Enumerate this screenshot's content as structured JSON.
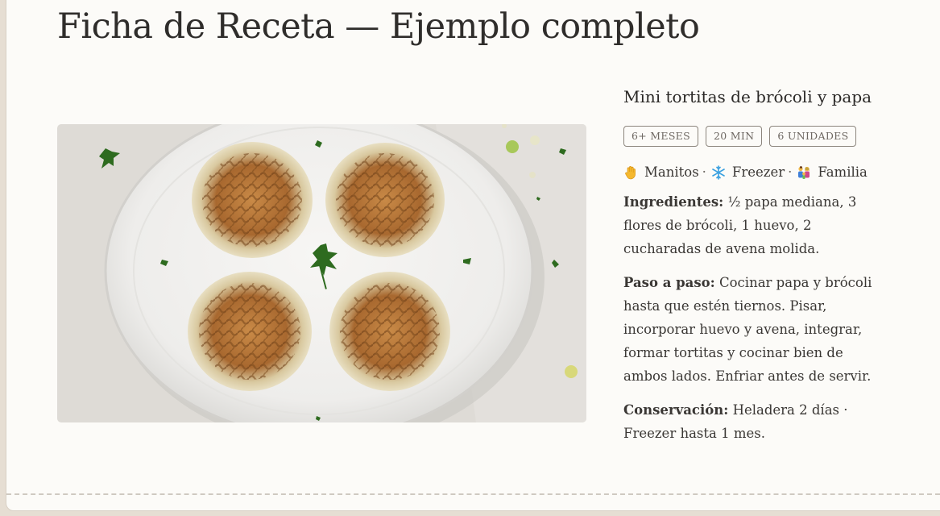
{
  "page": {
    "title": "Ficha de Receta — Ejemplo completo"
  },
  "recipe": {
    "title": "Mini tortitas de brócoli y papa",
    "tags": [
      "6+ MESES",
      "20 MIN",
      "6 UNIDADES"
    ],
    "features": [
      {
        "icon": "raised-hand-icon",
        "label": "Manitos"
      },
      {
        "icon": "snowflake-icon",
        "label": "Freezer"
      },
      {
        "icon": "family-icon",
        "label": "Familia"
      }
    ],
    "separator": "·",
    "ingredients_label": "Ingredientes:",
    "ingredients_text": "½ papa mediana, 3 flores de brócoli, 1 huevo, 2 cucharadas de avena molida.",
    "steps_label": "Paso a paso:",
    "steps_text": "Cocinar papa y brócoli hasta que estén tiernos. Pisar, incorporar huevo y avena, integrar, formar tortitas y cocinar bien de ambos lados. Enfriar antes de servir.",
    "storage_label": "Conservación:",
    "storage_text": "Heladera 2 días · Freezer hasta 1 mes."
  },
  "colors": {
    "page_bg": "#fcfbf8",
    "outer_bg": "#e6ded3",
    "text": "#3a3734",
    "tag_border": "#8c857d"
  }
}
